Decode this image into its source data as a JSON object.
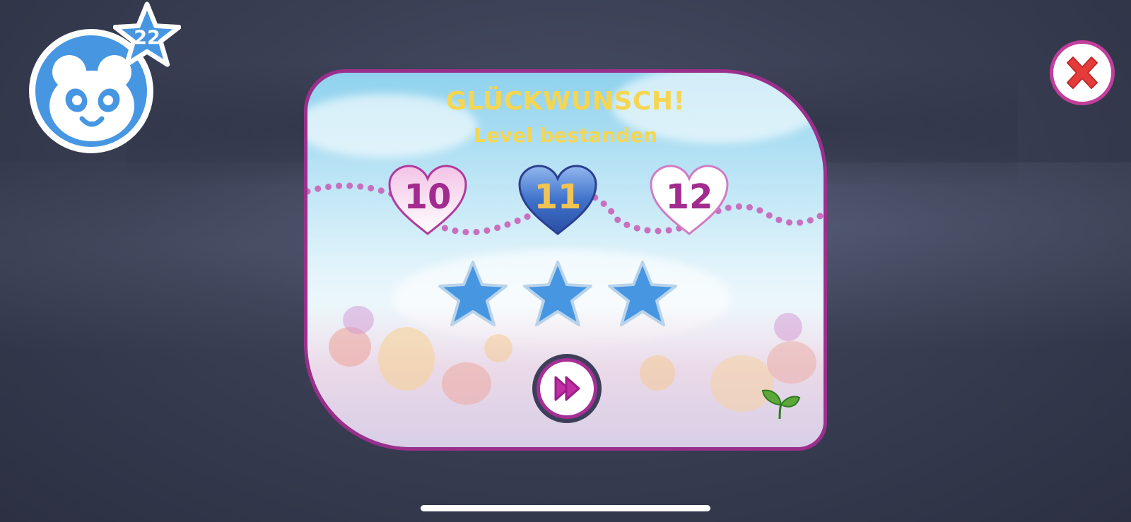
{
  "player": {
    "avatar_icon": "panda-face-icon",
    "star_badge_icon": "star-icon",
    "star_count": "22"
  },
  "close_button": {
    "icon": "close-x-icon"
  },
  "dialog": {
    "title": "GLÜCKWUNSCH!",
    "subtitle": "Level bestanden",
    "levels": [
      {
        "number": "10",
        "state": "completed"
      },
      {
        "number": "11",
        "state": "current"
      },
      {
        "number": "12",
        "state": "next"
      }
    ],
    "stars_earned": 3,
    "stars_total": 3,
    "next_button_icon": "fast-forward-icon",
    "decoration_icon": "sprout-icon"
  },
  "colors": {
    "accent_magenta": "#a52f94",
    "title_yellow": "#f6d651",
    "star_blue": "#4696e2",
    "current_level_blue": "#2f5fb8",
    "close_red": "#e53b3b"
  }
}
